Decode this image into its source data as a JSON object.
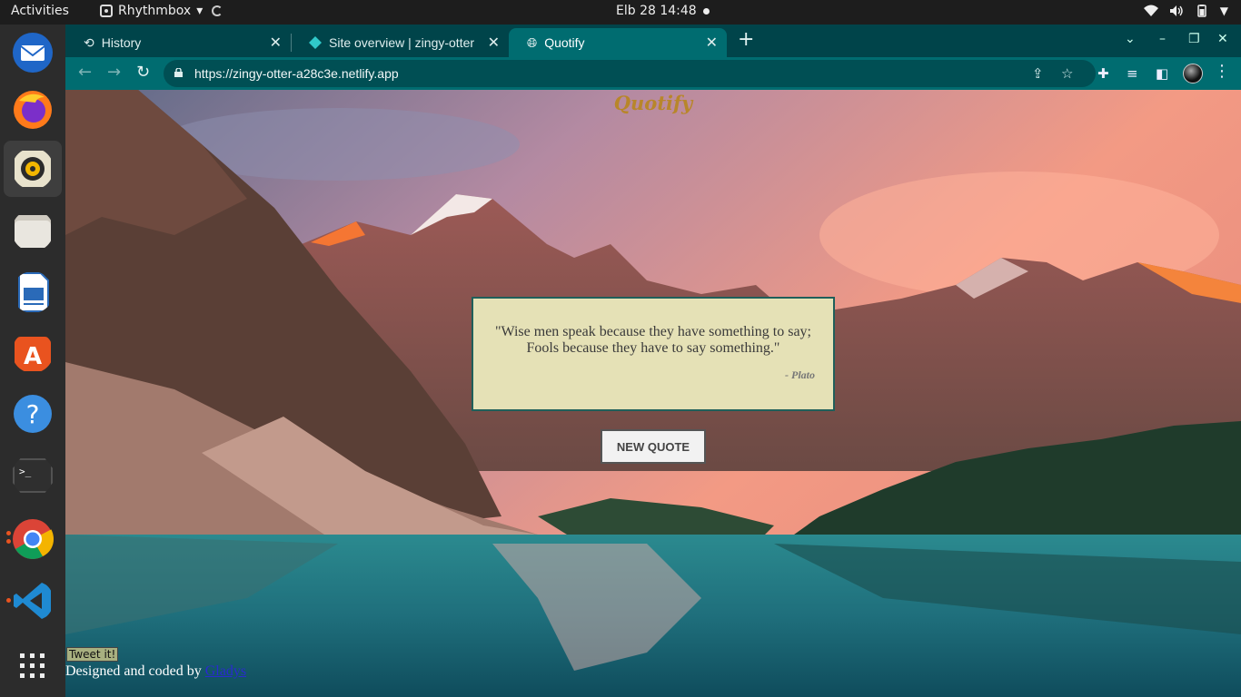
{
  "topbar": {
    "activities": "Activities",
    "app_name": "Rhythmbox",
    "clock": "Elb 28  14:48"
  },
  "dock": {
    "items": [
      {
        "name": "thunderbird"
      },
      {
        "name": "firefox"
      },
      {
        "name": "rhythmbox",
        "active": true
      },
      {
        "name": "files"
      },
      {
        "name": "libreoffice-writer"
      },
      {
        "name": "ubuntu-software"
      },
      {
        "name": "help"
      },
      {
        "name": "terminal"
      },
      {
        "name": "chrome",
        "running": true
      },
      {
        "name": "vscode",
        "running": true
      },
      {
        "name": "show-applications"
      }
    ]
  },
  "browser": {
    "tabs": [
      {
        "title": "History",
        "icon": "history-icon"
      },
      {
        "title": "Site overview | zingy-otter",
        "icon": "netlify-icon"
      },
      {
        "title": "Quotify",
        "icon": "globe-icon",
        "active": true
      }
    ],
    "url": "https://zingy-otter-a28c3e.netlify.app"
  },
  "page": {
    "title": "Quotify",
    "quote": "\"Wise men speak because they have something to say; Fools because they have to say something.\"",
    "author": "- Plato",
    "new_quote_label": "NEW QUOTE",
    "tweet_label": "Tweet it!",
    "credit_prefix": "Designed and coded by ",
    "credit_link": "Gladys"
  },
  "colors": {
    "tabstrip": "#00444a",
    "toolbar": "#006c70",
    "title": "#b8862a",
    "quote_bg": "#e5e1b6"
  }
}
